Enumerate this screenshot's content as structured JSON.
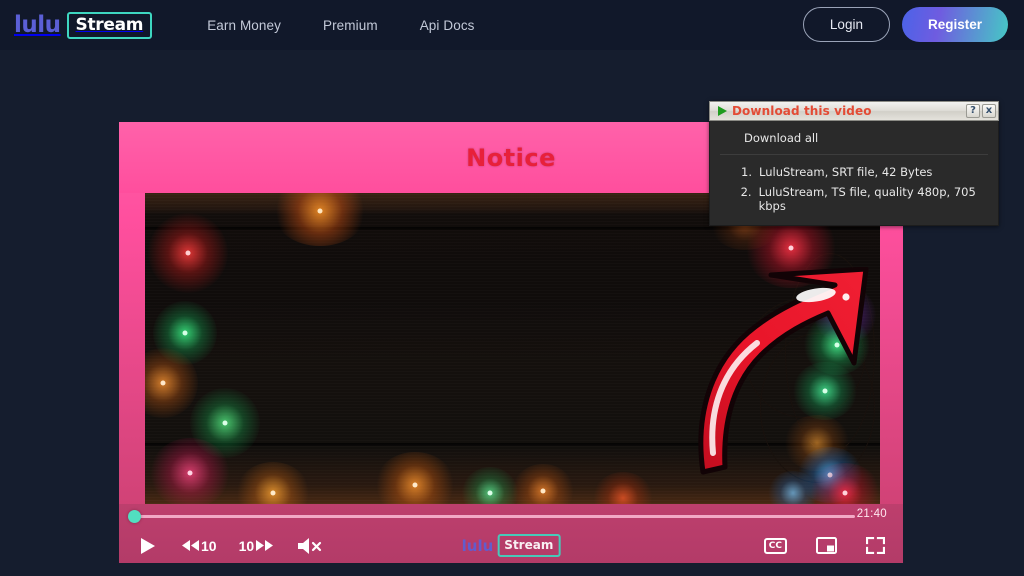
{
  "header": {
    "logo": {
      "primary": "lulu",
      "boxed": "Stream"
    },
    "nav": [
      {
        "label": "Earn Money"
      },
      {
        "label": "Premium"
      },
      {
        "label": "Api Docs"
      }
    ],
    "login_label": "Login",
    "register_label": "Register"
  },
  "player": {
    "notice_text": "Notice",
    "current_time_label": "21:40",
    "watermark": {
      "primary": "lulu",
      "boxed": "Stream"
    },
    "controls": {
      "play_icon": "play-icon",
      "rewind_label": "10",
      "forward_label": "10",
      "volume_icon": "volume-muted-icon",
      "cc_label": "CC",
      "pip_icon": "picture-in-picture-icon",
      "fullscreen_icon": "fullscreen-icon"
    }
  },
  "annotation": {
    "arrow_icon": "curved-red-arrow-icon"
  },
  "popup": {
    "title": "Download this video",
    "title_play_icon": "green-play-icon",
    "help_label": "?",
    "close_label": "x",
    "download_all_label": "Download all",
    "items": [
      {
        "num": "1.",
        "text": "LuluStream,  SRT file, 42 Bytes"
      },
      {
        "num": "2.",
        "text": "LuluStream,  TS file, quality 480p, 705 kbps"
      }
    ]
  },
  "colors": {
    "page_bg": "#151d2e",
    "header_bg": "#11182a",
    "accent_teal": "#3ed6c0",
    "accent_indigo": "#5b5fd6",
    "player_pink": "#ff4f9e",
    "popup_title_red": "#e34b35",
    "arrow_red": "#e8152b"
  }
}
